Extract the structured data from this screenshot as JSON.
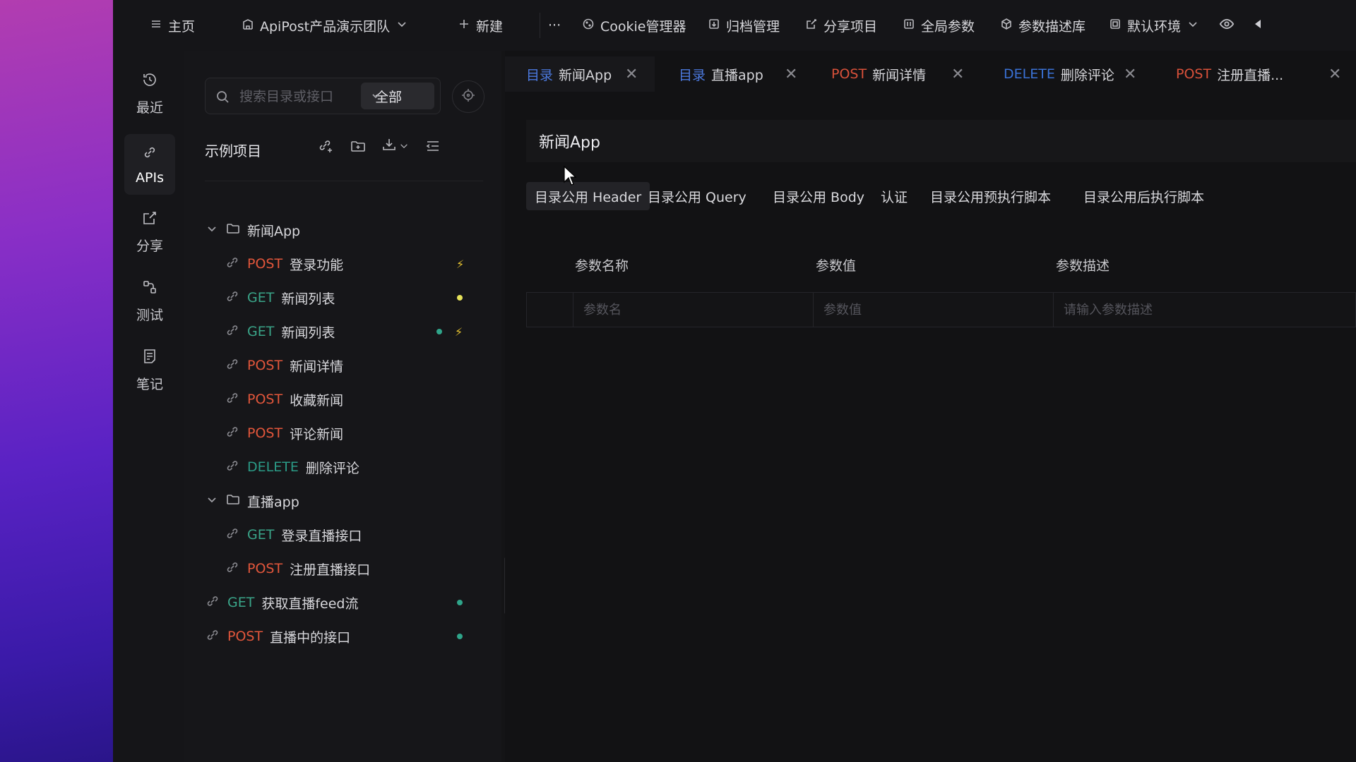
{
  "topbar": {
    "home": "主页",
    "team": "ApiPost产品演示团队",
    "new": "新建",
    "more": "···",
    "cookie": "Cookie管理器",
    "archive": "归档管理",
    "share": "分享项目",
    "global_params": "全局参数",
    "param_lib": "参数描述库",
    "env": "默认环境"
  },
  "rail": {
    "items": [
      {
        "label": "最近",
        "icon": "clock-icon"
      },
      {
        "label": "APIs",
        "icon": "link-icon"
      },
      {
        "label": "分享",
        "icon": "share-icon"
      },
      {
        "label": "测试",
        "icon": "test-icon"
      },
      {
        "label": "笔记",
        "icon": "note-icon"
      }
    ]
  },
  "sidebar": {
    "search_placeholder": "搜索目录或接口",
    "filter": "全部",
    "project_title": "示例项目",
    "tree": [
      {
        "type": "folder",
        "name": "新闻App"
      },
      {
        "method": "POST",
        "name": "登录功能",
        "marks": [
          "bolt"
        ]
      },
      {
        "method": "GET",
        "name": "新闻列表",
        "marks": [
          "yellow-dot"
        ]
      },
      {
        "method": "GET",
        "name": "新闻列表",
        "marks": [
          "green-dot",
          "bolt"
        ]
      },
      {
        "method": "POST",
        "name": "新闻详情",
        "marks": []
      },
      {
        "method": "POST",
        "name": "收藏新闻",
        "marks": []
      },
      {
        "method": "POST",
        "name": "评论新闻",
        "marks": []
      },
      {
        "method": "DELETE",
        "name": "删除评论",
        "marks": []
      },
      {
        "type": "folder",
        "name": "直播app"
      },
      {
        "method": "GET",
        "name": "登录直播接口",
        "marks": []
      },
      {
        "method": "POST",
        "name": "注册直播接口",
        "marks": []
      },
      {
        "method": "GET",
        "name": "获取直播feed流",
        "marks": [
          "green-dot"
        ]
      },
      {
        "method": "POST",
        "name": "直播中的接口",
        "marks": [
          "green-dot"
        ]
      }
    ]
  },
  "tabs": [
    {
      "prefix": "目录",
      "name": "新闻App"
    },
    {
      "prefix": "目录",
      "name": "直播app"
    },
    {
      "prefix": "POST",
      "name": "新闻详情"
    },
    {
      "prefix": "DELETE",
      "name": "删除评论"
    },
    {
      "prefix": "POST",
      "name": "注册直播..."
    }
  ],
  "main": {
    "title": "新闻App",
    "subtabs": [
      "目录公用 Header",
      "目录公用 Query",
      "目录公用 Body",
      "认证",
      "目录公用预执行脚本",
      "目录公用后执行脚本"
    ],
    "columns": [
      "参数名称",
      "参数值",
      "参数描述"
    ],
    "placeholders": {
      "name": "参数名",
      "value": "参数值",
      "desc": "请输入参数描述"
    }
  },
  "colors": {
    "post": "#e2563b",
    "get": "#3aa589",
    "delete": "#2b9b87",
    "dir_prefix": "#4c7ae0"
  }
}
